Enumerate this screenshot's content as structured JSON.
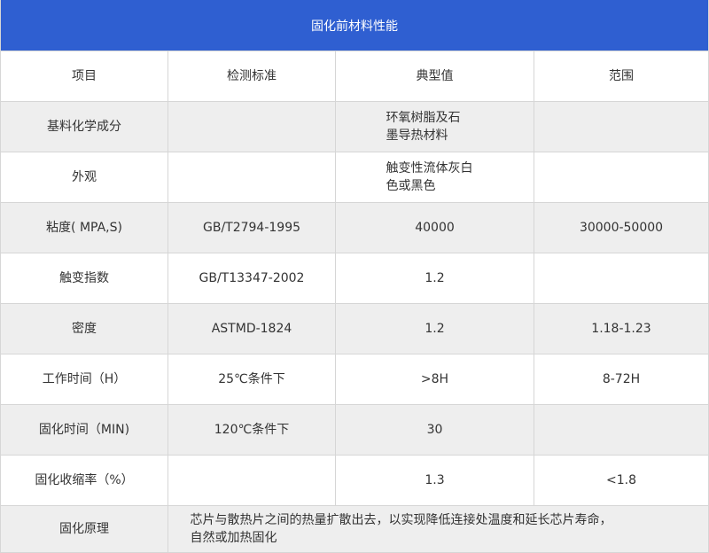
{
  "title": "固化前材料性能",
  "headers": [
    "项目",
    "检测标准",
    "典型值",
    "范围"
  ],
  "rows": [
    {
      "item": "基料化学成分",
      "standard": "",
      "typical": "环氧树脂及石\n墨导热材料",
      "range": ""
    },
    {
      "item": "外观",
      "standard": "",
      "typical": "触变性流体灰白\n色或黑色",
      "range": ""
    },
    {
      "item": "粘度( MPA,S)",
      "standard": "GB/T2794-1995",
      "typical": "40000",
      "range": "30000-50000"
    },
    {
      "item": "触变指数",
      "standard": "GB/T13347-2002",
      "typical": "1.2",
      "range": ""
    },
    {
      "item": "密度",
      "standard": "ASTMD-1824",
      "typical": "1.2",
      "range": "1.18-1.23"
    },
    {
      "item": "工作时间（H）",
      "standard": "25℃条件下",
      "typical": ">8H",
      "range": "8-72H"
    },
    {
      "item": "固化时间（MIN)",
      "standard": "120℃条件下",
      "typical": "30",
      "range": ""
    },
    {
      "item": "固化收缩率（%）",
      "standard": "",
      "typical": "1.3",
      "range": "<1.8"
    }
  ],
  "principle": {
    "item": "固化原理",
    "text": "芯片与散热片之间的热量扩散出去，以实现降低连接处温度和延长芯片寿命，\n自然或加热固化"
  }
}
